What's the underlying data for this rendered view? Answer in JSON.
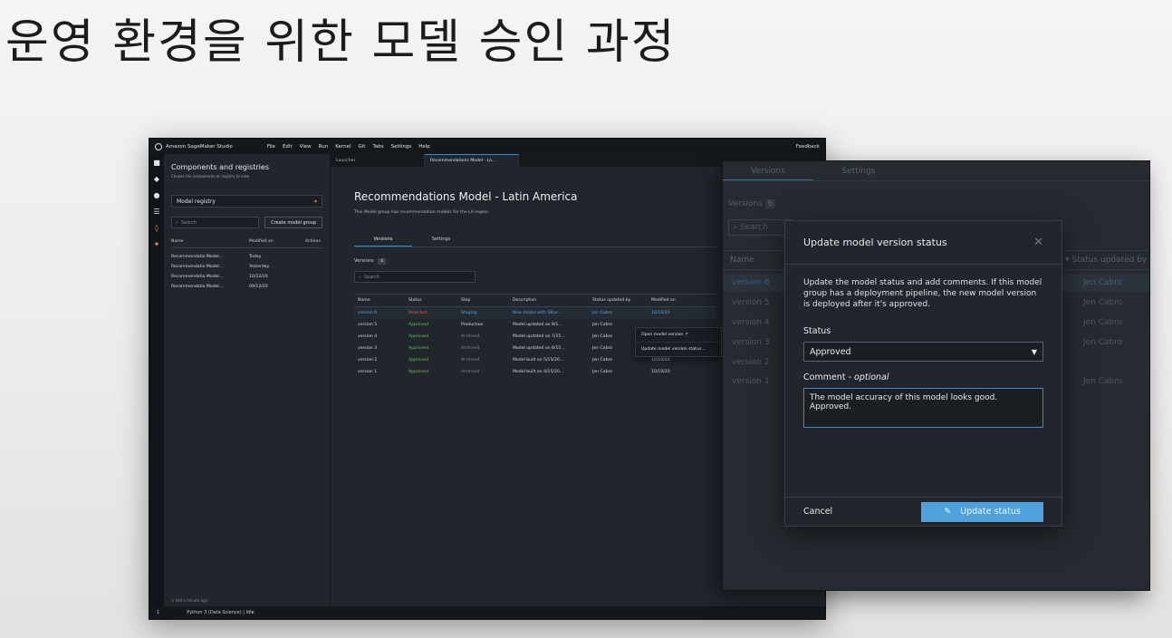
{
  "slide": {
    "title": "운영 환경을 위한 모델 승인 과정"
  },
  "studio": {
    "app_name": "Amazon SageMaker Studio",
    "menu": [
      "File",
      "Edit",
      "View",
      "Run",
      "Kernel",
      "Git",
      "Tabs",
      "Settings",
      "Help"
    ],
    "feedback": "Feedback",
    "status_bar": {
      "count": "1",
      "kernel": "Python 3 (Data Science) | Idle"
    }
  },
  "left_panel": {
    "title": "Components and registries",
    "subtitle": "Choose the components or registry to view",
    "selected": "Model registry",
    "search_placeholder": "Search",
    "create_button": "Create model group",
    "columns": [
      "Name",
      "Modified on",
      "Actions"
    ],
    "rows": [
      {
        "name": "Recommendatio Model...",
        "modified": "Today"
      },
      {
        "name": "Recommendatio Model...",
        "modified": "Yesterday"
      },
      {
        "name": "Recommendatio Model...",
        "modified": "10/22/20"
      },
      {
        "name": "Recommendatio Model...",
        "modified": "09/12/20"
      }
    ],
    "footer": "half a minute ago"
  },
  "tabs": [
    "Launcher",
    "Recommendations Model - La..."
  ],
  "content": {
    "title": "Recommendations Model - Latin America",
    "description": "This Model group has recommendation models for the LA region.",
    "subtabs": [
      "Versions",
      "Settings"
    ],
    "versions_label": "Versions",
    "versions_count": "6",
    "search_placeholder": "Search",
    "columns": [
      "Name",
      "Status",
      "Step",
      "Description",
      "Status updated by",
      "Modified on"
    ],
    "rows": [
      {
        "name": "version 6",
        "status": "Rejected",
        "step": "Staging",
        "desc": "New model with SKLe...",
        "by": "Jen Cabro",
        "modified": "10/10/20"
      },
      {
        "name": "version 5",
        "status": "Approved",
        "step": "Production",
        "desc": "Model updated on 8/1...",
        "by": "Jen Cabro",
        "modified": ""
      },
      {
        "name": "version 4",
        "status": "Approved",
        "step": "Archived",
        "desc": "Model updated on 7/15...",
        "by": "Jen Cabro",
        "modified": ""
      },
      {
        "name": "version 3",
        "status": "Approved",
        "step": "Archived",
        "desc": "Model updated on 6/15...",
        "by": "Jen Cabro",
        "modified": ""
      },
      {
        "name": "version 2",
        "status": "Approved",
        "step": "Archived",
        "desc": "Model built on 5/15/20...",
        "by": "Jen Cabro",
        "modified": "10/10/20"
      },
      {
        "name": "version 1",
        "status": "Approved",
        "step": "Archived",
        "desc": "Model built on 4/15/20...",
        "by": "Jen Cabro",
        "modified": "10/10/20"
      }
    ],
    "context_menu": [
      "Open model version ↗",
      "Update model version status..."
    ]
  },
  "zoom_panel": {
    "tabs": [
      "Versions",
      "Settings"
    ],
    "versions_label": "Versions",
    "versions_count": "6",
    "search_placeholder": "Search",
    "name_header": "Name",
    "status_updated_header": "Status updated by",
    "rows": [
      "version 6",
      "version 5",
      "version 4",
      "version 3",
      "version 2",
      "version 1"
    ],
    "updated_by": [
      "Jen Cabro",
      "Jen Cabro",
      "Jen Cabro",
      "Jen Cabro",
      "Jen Cabro"
    ]
  },
  "modal": {
    "title": "Update model version status",
    "close": "✕",
    "description": "Update the model status and add comments. If this model group has a deployment pipeline, the new model version is deployed after it's approved.",
    "status_label": "Status",
    "status_value": "Approved",
    "comment_label": "Comment - ",
    "comment_optional": "optional",
    "comment_value": "The model accuracy of this model looks good. Approved.",
    "cancel": "Cancel",
    "update": "Update status"
  }
}
